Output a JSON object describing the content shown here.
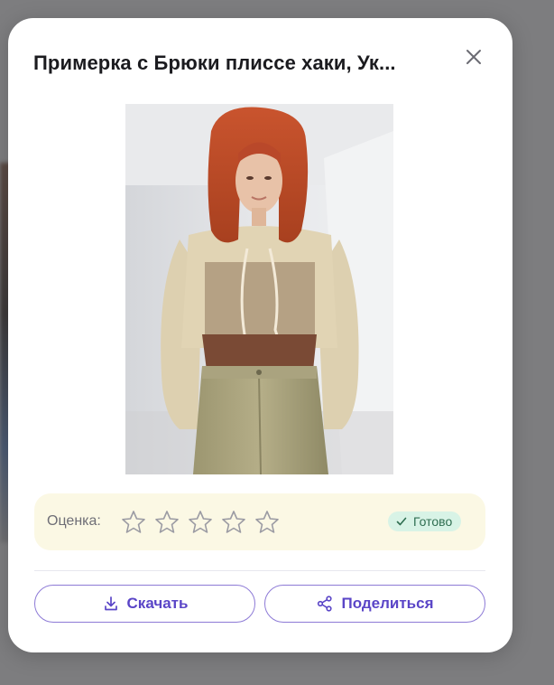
{
  "dialog": {
    "title": "Примерка с Брюки плиссе хаки, Ук...",
    "close_icon": "close-icon"
  },
  "rating": {
    "label": "Оценка:",
    "stars_total": 5,
    "stars_selected": 0,
    "status": "Готово",
    "status_color": "#d8f3e6"
  },
  "actions": {
    "download_label": "Скачать",
    "share_label": "Поделиться",
    "accent_color": "#5a45c7"
  }
}
